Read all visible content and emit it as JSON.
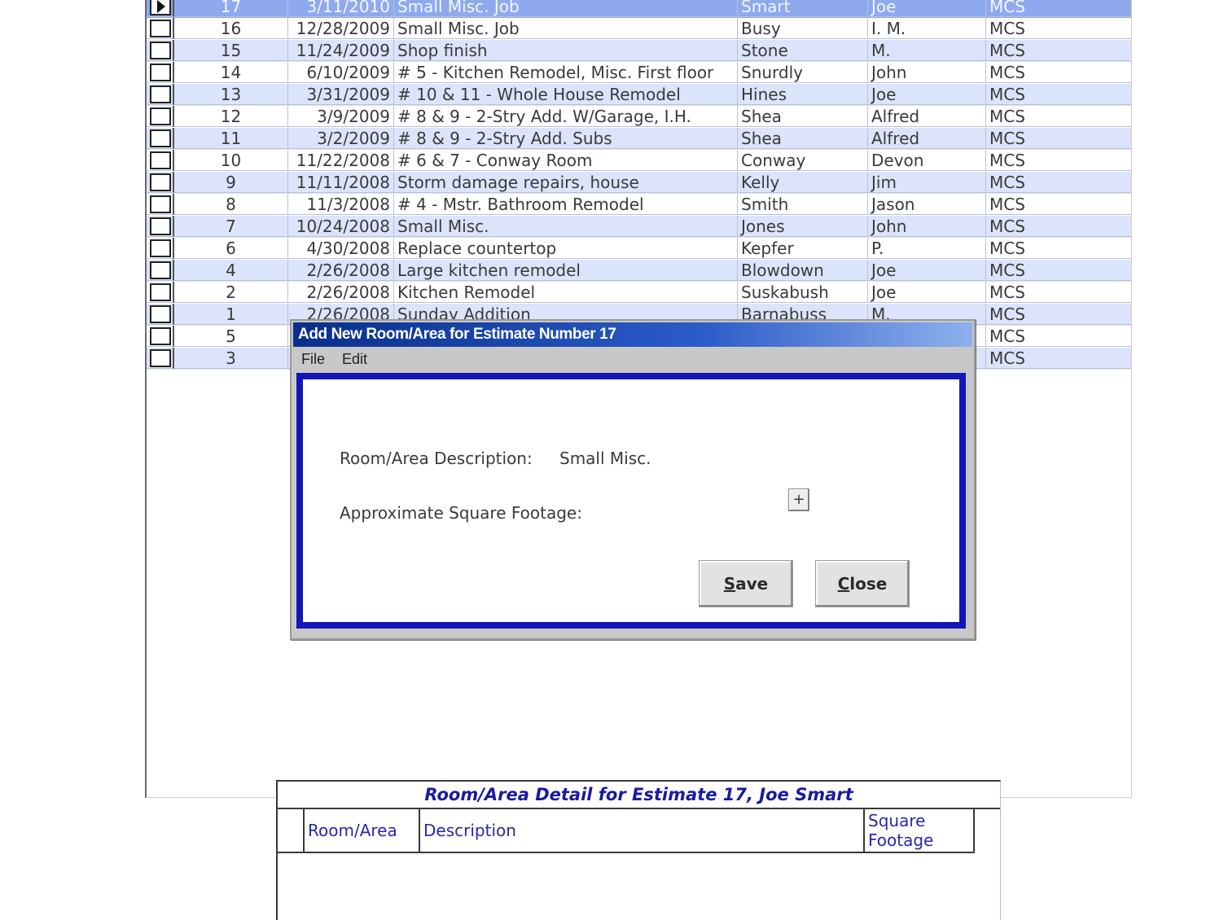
{
  "estimates": {
    "rows": [
      {
        "num": "17",
        "date": "3/11/2010",
        "description": "Small Misc. Job",
        "last": "Smart",
        "first": "Joe",
        "company": "MCS",
        "selected": true
      },
      {
        "num": "16",
        "date": "12/28/2009",
        "description": "Small Misc. Job",
        "last": "Busy",
        "first": "I. M.",
        "company": "MCS"
      },
      {
        "num": "15",
        "date": "11/24/2009",
        "description": "Shop finish",
        "last": "Stone",
        "first": "M.",
        "company": "MCS"
      },
      {
        "num": "14",
        "date": "6/10/2009",
        "description": "# 5 - Kitchen Remodel, Misc. First floor",
        "last": "Snurdly",
        "first": "John",
        "company": "MCS"
      },
      {
        "num": "13",
        "date": "3/31/2009",
        "description": "# 10 & 11 - Whole House Remodel",
        "last": "Hines",
        "first": "Joe",
        "company": "MCS"
      },
      {
        "num": "12",
        "date": "3/9/2009",
        "description": "# 8 & 9 - 2-Stry Add. W/Garage, I.H.",
        "last": "Shea",
        "first": "Alfred",
        "company": "MCS"
      },
      {
        "num": "11",
        "date": "3/2/2009",
        "description": "# 8 & 9 - 2-Stry Add. Subs",
        "last": "Shea",
        "first": "Alfred",
        "company": "MCS"
      },
      {
        "num": "10",
        "date": "11/22/2008",
        "description": "# 6 & 7 - Conway Room",
        "last": "Conway",
        "first": "Devon",
        "company": "MCS"
      },
      {
        "num": "9",
        "date": "11/11/2008",
        "description": "Storm damage repairs, house",
        "last": "Kelly",
        "first": "Jim",
        "company": "MCS"
      },
      {
        "num": "8",
        "date": "11/3/2008",
        "description": "# 4 - Mstr. Bathroom Remodel",
        "last": "Smith",
        "first": "Jason",
        "company": "MCS"
      },
      {
        "num": "7",
        "date": "10/24/2008",
        "description": "Small Misc.",
        "last": "Jones",
        "first": "John",
        "company": "MCS"
      },
      {
        "num": "6",
        "date": "4/30/2008",
        "description": "Replace countertop",
        "last": "Kepfer",
        "first": "P.",
        "company": "MCS"
      },
      {
        "num": "4",
        "date": "2/26/2008",
        "description": "Large kitchen remodel",
        "last": "Blowdown",
        "first": "Joe",
        "company": "MCS"
      },
      {
        "num": "2",
        "date": "2/26/2008",
        "description": "Kitchen Remodel",
        "last": "Suskabush",
        "first": "Joe",
        "company": "MCS"
      },
      {
        "num": "1",
        "date": "2/26/2008",
        "description": "Sunday Addition",
        "last": "Barnabuss",
        "first": "M.",
        "company": "MCS"
      },
      {
        "num": "5",
        "date": "",
        "description": "",
        "last": "",
        "first": "",
        "company": "MCS"
      },
      {
        "num": "3",
        "date": "",
        "description": "",
        "last": "",
        "first": "",
        "company": "MCS"
      }
    ],
    "colors": {
      "alt_row": "#dbe4fa",
      "selected_row": "#8fa9ee"
    }
  },
  "dialog": {
    "title": "Add New Room/Area for Estimate Number 17",
    "menu": [
      "File",
      "Edit"
    ],
    "description_label": "Room/Area Description:",
    "description_value": "Small Misc.",
    "sqft_label": "Approximate Square Footage:",
    "spin_icon": "+",
    "save_label": "Save",
    "close_label": "Close",
    "colors": {
      "title_bar": "#0a2f8a",
      "frame": "#1414b8"
    }
  },
  "detail": {
    "title": "Room/Area Detail for Estimate 17, Joe Smart",
    "columns": [
      "Room/Area",
      "Description",
      "Square Footage"
    ]
  }
}
